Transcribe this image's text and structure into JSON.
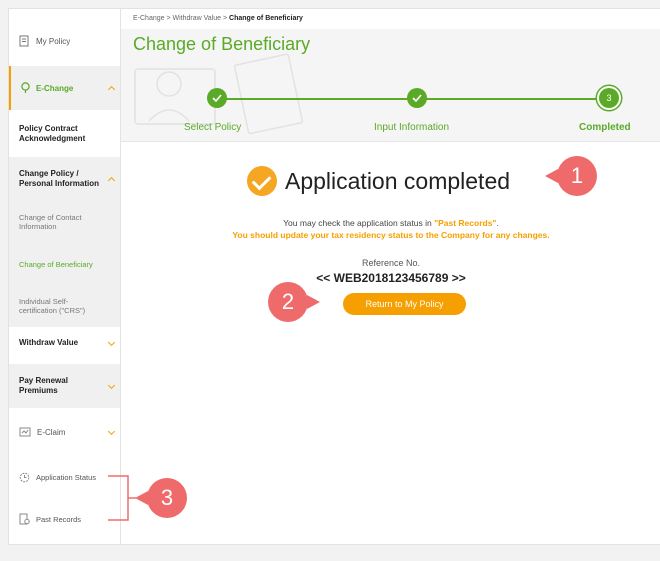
{
  "sidebar": {
    "my_policy": "My Policy",
    "echange": "E-Change",
    "policy_contract": "Policy Contract Acknowledgment",
    "change_policy": "Change Policy / Personal Information",
    "change_contact": "Change of Contact Information",
    "change_beneficiary": "Change of Beneficiary",
    "crs": "Individual Self-certification (\"CRS\")",
    "withdraw_value": "Withdraw Value",
    "pay_renewal": "Pay Renewal Premiums",
    "eclaim": "E-Claim",
    "application_status": "Application Status",
    "past_records": "Past Records"
  },
  "breadcrumb": {
    "item1": "E-Change",
    "item2": "Withdraw Value",
    "item3": "Change of Beneficiary",
    "sep": ">"
  },
  "page_title": "Change of Beneficiary",
  "steps": [
    {
      "label": "Select Policy",
      "status": "done"
    },
    {
      "label": "Input Information",
      "status": "done"
    },
    {
      "label": "Completed",
      "status": "current",
      "number": "3"
    }
  ],
  "result": {
    "title": "Application completed",
    "msg_pre": "You may check the application status in ",
    "msg_link": "\"Past Records\"",
    "msg_post": ".",
    "msg_tax": "You should update your tax residency status to the Company for any changes.",
    "ref_label": "Reference No.",
    "ref_number": "<< WEB2018123456789 >>",
    "button_label": "Return to My Policy"
  },
  "callouts": [
    "1",
    "2",
    "3"
  ],
  "colors": {
    "green": "#5aaa28",
    "orange": "#f5a000",
    "callout": "#ef6b6b"
  }
}
